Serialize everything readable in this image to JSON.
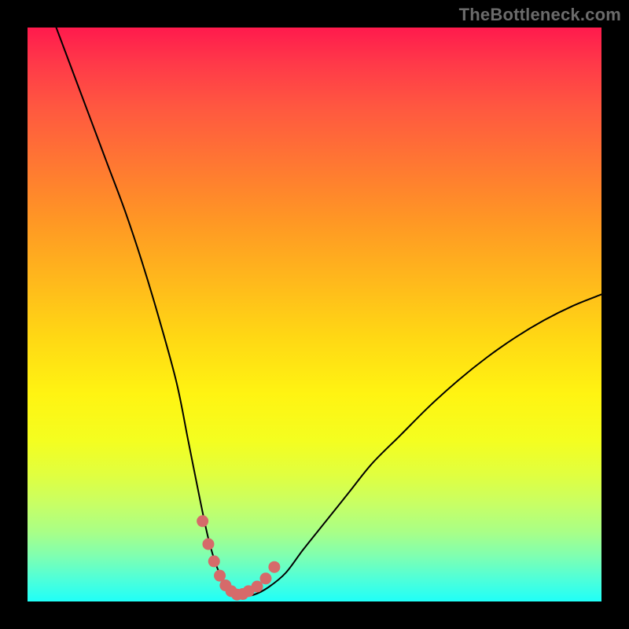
{
  "watermark": "TheBottleneck.com",
  "colors": {
    "curve": "#000000",
    "dots": "#d66a6a"
  },
  "chart_data": {
    "type": "line",
    "title": "",
    "xlabel": "",
    "ylabel": "",
    "xlim": [
      0,
      100
    ],
    "ylim": [
      0,
      100
    ],
    "x": [
      5,
      8,
      11,
      14,
      17,
      20,
      23,
      26,
      28,
      30,
      31.5,
      33,
      34.5,
      36,
      37.5,
      39.5,
      42,
      45,
      48,
      52,
      56,
      60,
      65,
      70,
      75,
      80,
      85,
      90,
      95,
      100
    ],
    "y": [
      100,
      92,
      84,
      76,
      68,
      59,
      49,
      38,
      28,
      18,
      11,
      6,
      3,
      1.5,
      1,
      1.2,
      2.5,
      5,
      9,
      14,
      19,
      24,
      29,
      34,
      38.5,
      42.5,
      46,
      49,
      51.5,
      53.5
    ],
    "optimal_points": {
      "x": [
        30.5,
        31.5,
        32.5,
        33.5,
        34.5,
        35.5,
        36.5,
        37.5,
        38.5,
        40,
        41.5,
        43
      ],
      "y": [
        14,
        10,
        7,
        4.5,
        2.8,
        1.8,
        1.2,
        1.3,
        1.8,
        2.6,
        4,
        6
      ]
    }
  }
}
